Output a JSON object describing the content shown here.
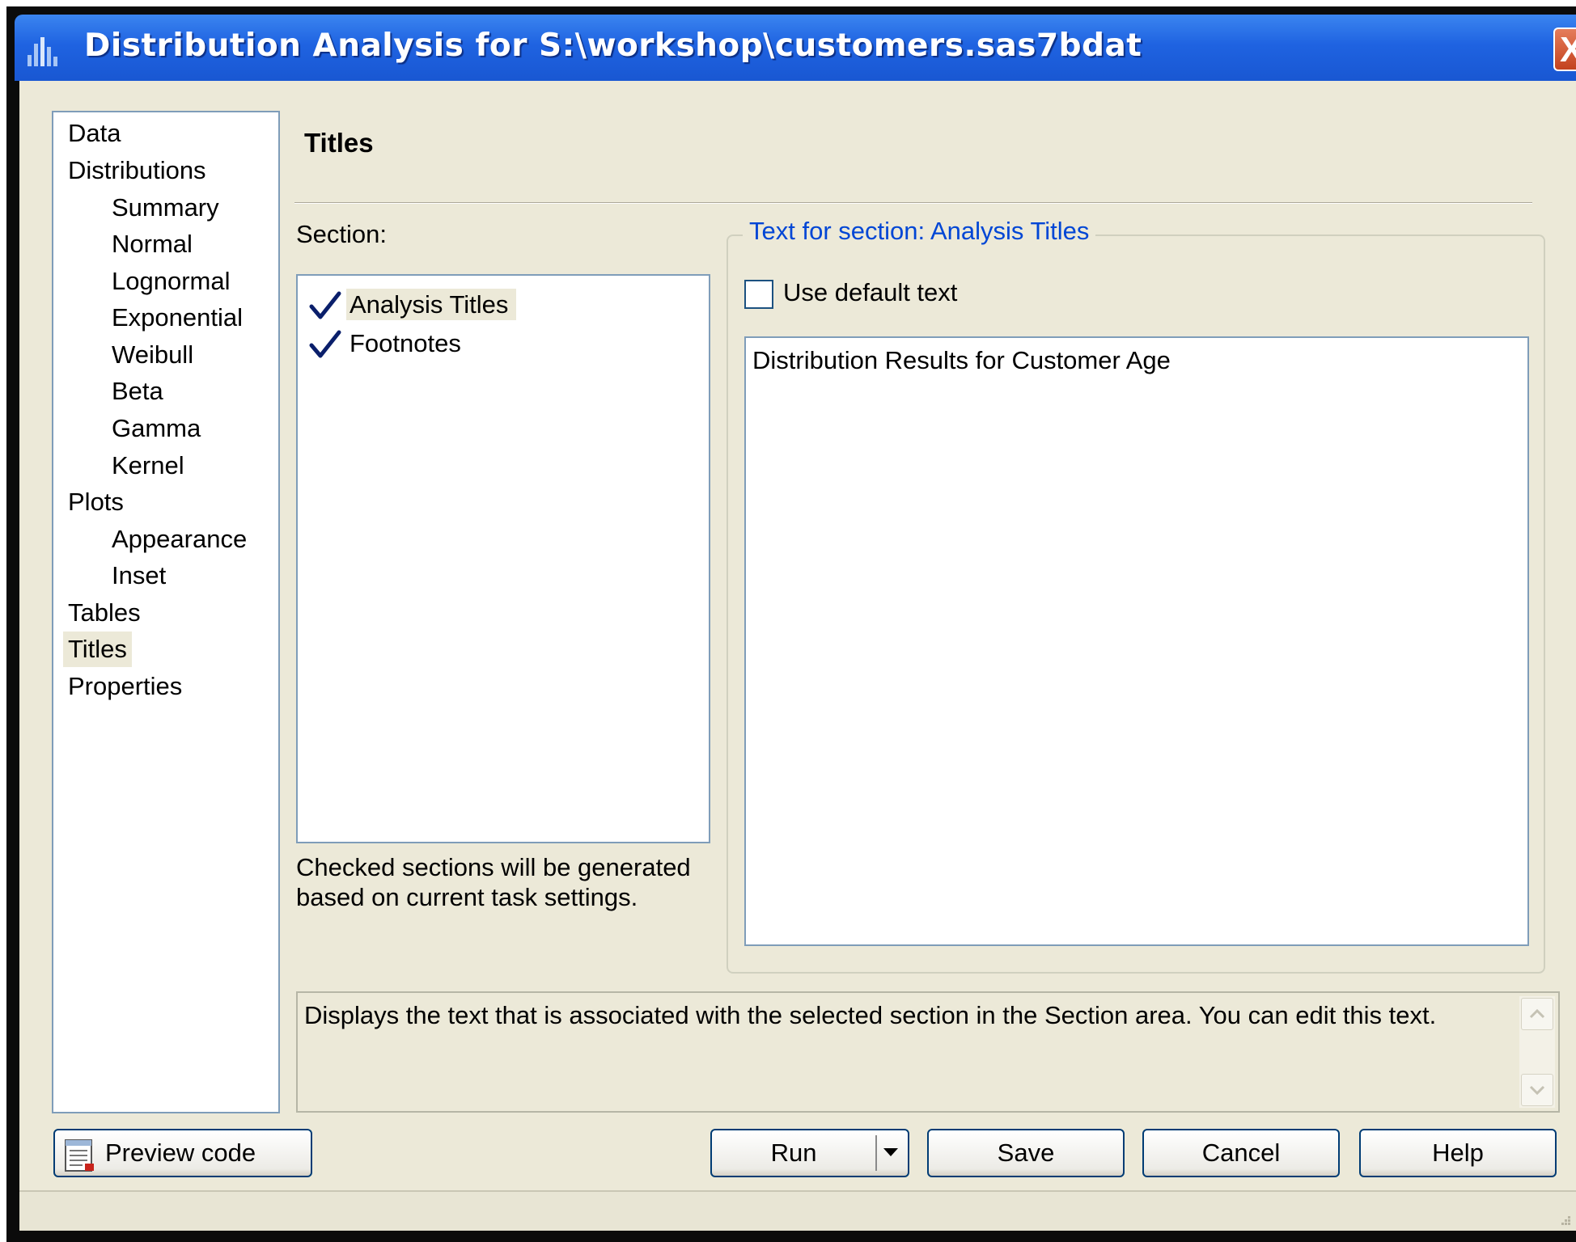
{
  "window": {
    "title": "Distribution Analysis for S:\\workshop\\customers.sas7bdat",
    "close_label": "X",
    "title_icon": "bar-chart-icon"
  },
  "nav": {
    "items": [
      {
        "label": "Data",
        "level": 0
      },
      {
        "label": "Distributions",
        "level": 0
      },
      {
        "label": "Summary",
        "level": 1
      },
      {
        "label": "Normal",
        "level": 1
      },
      {
        "label": "Lognormal",
        "level": 1
      },
      {
        "label": "Exponential",
        "level": 1
      },
      {
        "label": "Weibull",
        "level": 1
      },
      {
        "label": "Beta",
        "level": 1
      },
      {
        "label": "Gamma",
        "level": 1
      },
      {
        "label": "Kernel",
        "level": 1
      },
      {
        "label": "Plots",
        "level": 0
      },
      {
        "label": "Appearance",
        "level": 1
      },
      {
        "label": "Inset",
        "level": 1
      },
      {
        "label": "Tables",
        "level": 0
      },
      {
        "label": "Titles",
        "level": 0,
        "selected": true
      },
      {
        "label": "Properties",
        "level": 0
      }
    ]
  },
  "main": {
    "heading": "Titles",
    "section_label": "Section:",
    "sections": [
      {
        "label": "Analysis Titles",
        "checked": true,
        "selected": true
      },
      {
        "label": "Footnotes",
        "checked": true,
        "selected": false
      }
    ],
    "section_note": "Checked sections will be generated based on current task settings.",
    "group_title": "Text for section: Analysis Titles",
    "use_default_label": "Use default text",
    "use_default_checked": false,
    "text_value": "Distribution Results for Customer Age",
    "description": "Displays the text that is associated with the selected section in the Section area.  You can edit this text."
  },
  "buttons": {
    "preview": "Preview code",
    "run": "Run",
    "save": "Save",
    "cancel": "Cancel",
    "help": "Help"
  },
  "colors": {
    "title_bar": "#1f63e1",
    "dialog_bg": "#ece9d8",
    "group_title": "#0046d5",
    "checkmark": "#0a1f6b"
  }
}
